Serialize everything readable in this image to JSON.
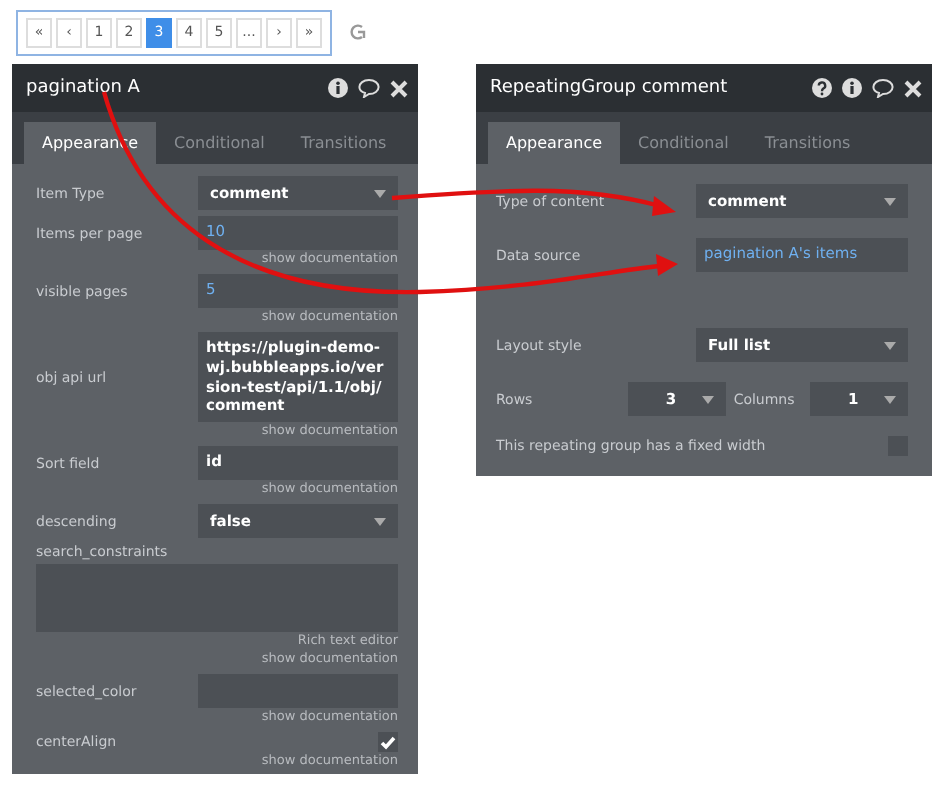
{
  "pagination": {
    "buttons": [
      {
        "label": "«",
        "selected": false
      },
      {
        "label": "‹",
        "selected": false
      },
      {
        "label": "1",
        "selected": false
      },
      {
        "label": "2",
        "selected": false
      },
      {
        "label": "3",
        "selected": true
      },
      {
        "label": "4",
        "selected": false
      },
      {
        "label": "5",
        "selected": false
      },
      {
        "label": "...",
        "selected": false
      },
      {
        "label": "›",
        "selected": false
      },
      {
        "label": "»",
        "selected": false
      }
    ]
  },
  "left_panel": {
    "title": "pagination A",
    "tabs": [
      {
        "label": "Appearance",
        "selected": true
      },
      {
        "label": "Conditional",
        "selected": false
      },
      {
        "label": "Transitions",
        "selected": false
      }
    ],
    "fields": [
      {
        "kind": "dropdown",
        "label": "Item Type",
        "value": "comment"
      },
      {
        "kind": "input",
        "label": "Items per page",
        "value": "10",
        "dynamic": true,
        "notes": [
          "show documentation"
        ]
      },
      {
        "kind": "input",
        "label": "visible pages",
        "value": "5",
        "dynamic": true,
        "notes": [
          "show documentation"
        ]
      },
      {
        "kind": "input",
        "label": "obj api url",
        "value": "https://plugin-demo-wj.bubbleapps.io/version-test/api/1.1/obj/comment",
        "dynamic": false,
        "notes": [
          "show documentation"
        ]
      },
      {
        "kind": "input",
        "label": "Sort field",
        "value": "id",
        "dynamic": false,
        "notes": [
          "show documentation"
        ]
      },
      {
        "kind": "dropdown",
        "label": "descending",
        "value": "false"
      },
      {
        "kind": "textarea",
        "label": "search_constraints",
        "notes": [
          "Rich text editor",
          "show documentation"
        ]
      },
      {
        "kind": "input",
        "label": "selected_color",
        "dynamic": false,
        "notes": [
          "show documentation"
        ]
      },
      {
        "kind": "checkbox",
        "label": "centerAlign",
        "checked": true,
        "notes": [
          "show documentation"
        ]
      }
    ]
  },
  "right_panel": {
    "title": "RepeatingGroup comment",
    "tabs": [
      {
        "label": "Appearance",
        "selected": true
      },
      {
        "label": "Conditional",
        "selected": false
      },
      {
        "label": "Transitions",
        "selected": false
      }
    ],
    "fields": [
      {
        "kind": "dropdown",
        "label": "Type of content",
        "value": "comment"
      },
      {
        "kind": "input",
        "label": "Data source",
        "value": "pagination A's items",
        "dynamic": true
      },
      {
        "kind": "spacer"
      },
      {
        "kind": "dropdown",
        "label": "Layout style",
        "value": "Full list"
      },
      {
        "kind": "pair",
        "label": "Rows",
        "value": "3",
        "label2": "Columns",
        "value2": "1"
      },
      {
        "kind": "checkbox",
        "label": "This repeating group has a fixed width",
        "checked": false
      }
    ]
  }
}
